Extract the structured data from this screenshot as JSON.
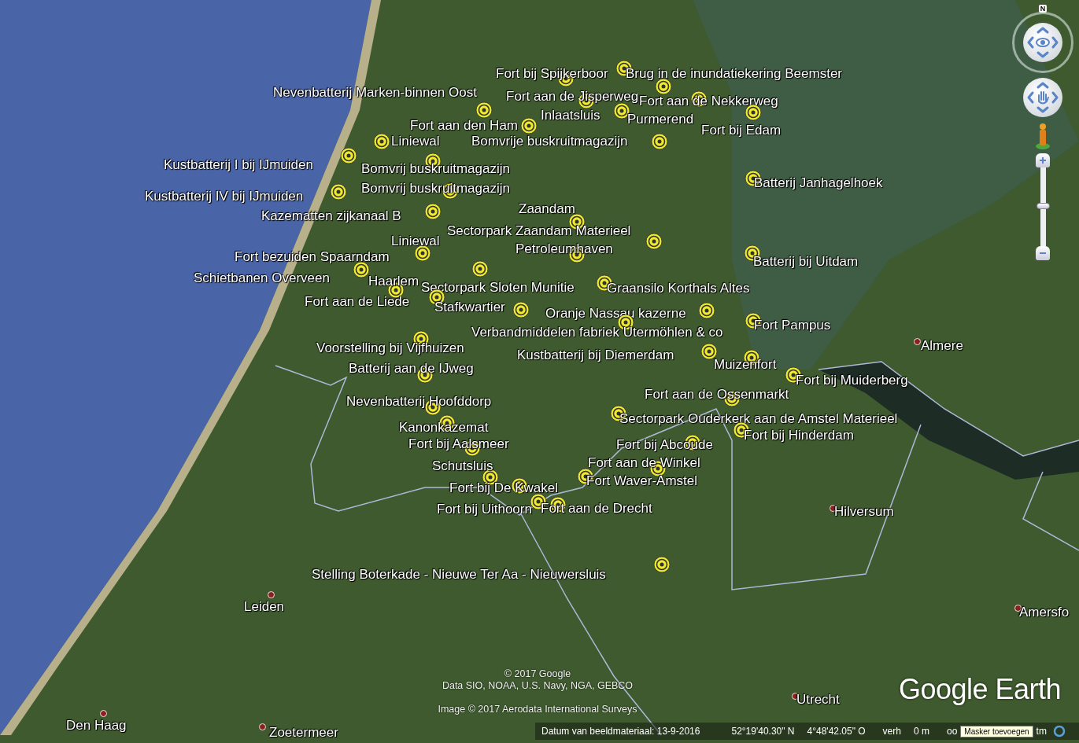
{
  "map": {
    "placemarks": [
      {
        "kind": "placemark",
        "label": "Fort bij Spijkerboor"
      },
      {
        "kind": "placemark",
        "label": "Brug in de inundatiekering Beemster"
      },
      {
        "kind": "placemark",
        "label": "Nevenbatterij Marken-binnen Oost"
      },
      {
        "kind": "placemark",
        "label": "Fort aan de Jisperweg"
      },
      {
        "kind": "placemark",
        "label": "Fort aan de Nekkerweg"
      },
      {
        "kind": "placemark",
        "label": "Inlaatsluis"
      },
      {
        "kind": "placemark",
        "label": "Purmerend"
      },
      {
        "kind": "placemark",
        "label": "Fort bij Edam"
      },
      {
        "kind": "placemark",
        "label": "Fort aan den Ham"
      },
      {
        "kind": "placemark",
        "label": "Liniewal"
      },
      {
        "kind": "placemark",
        "label": "Bomvrije buskruitmagazijn"
      },
      {
        "kind": "placemark",
        "label": "Kustbatterij I bij IJmuiden"
      },
      {
        "kind": "placemark",
        "label": "Bomvrij buskruitmagazijn"
      },
      {
        "kind": "placemark",
        "label": "Bomvrij buskruitmagazijn"
      },
      {
        "kind": "placemark",
        "label": "Kustbatterij IV bij IJmuiden"
      },
      {
        "kind": "placemark",
        "label": "Kazematten zijkanaal B"
      },
      {
        "kind": "placemark",
        "label": "Zaandam"
      },
      {
        "kind": "placemark",
        "label": "Batterij Janhagelhoek"
      },
      {
        "kind": "placemark",
        "label": "Liniewal"
      },
      {
        "kind": "placemark",
        "label": "Sectorpark Zaandam Materieel"
      },
      {
        "kind": "placemark",
        "label": "Petroleumhaven"
      },
      {
        "kind": "placemark",
        "label": "Batterij bij Uitdam"
      },
      {
        "kind": "placemark",
        "label": "Fort bezuiden Spaarndam"
      },
      {
        "kind": "placemark",
        "label": "Schietbanen Overveen"
      },
      {
        "kind": "placemark",
        "label": "Haarlem"
      },
      {
        "kind": "placemark",
        "label": "Sectorpark Sloten Munitie"
      },
      {
        "kind": "placemark",
        "label": "Graansilo Korthals Altes"
      },
      {
        "kind": "placemark",
        "label": "Fort aan de Liede"
      },
      {
        "kind": "placemark",
        "label": "Stafkwartier"
      },
      {
        "kind": "placemark",
        "label": "Oranje Nassau kazerne"
      },
      {
        "kind": "placemark",
        "label": "Fort Pampus"
      },
      {
        "kind": "placemark",
        "label": "Verbandmiddelen fabriek Utermöhlen & co"
      },
      {
        "kind": "placemark",
        "label": "Voorstelling bij Vijfhuizen"
      },
      {
        "kind": "placemark",
        "label": "Kustbatterij bij Diemerdam"
      },
      {
        "kind": "placemark",
        "label": "Muizenfort"
      },
      {
        "kind": "placemark",
        "label": "Batterij aan de IJweg"
      },
      {
        "kind": "city",
        "label": "Almere"
      },
      {
        "kind": "placemark",
        "label": "Fort bij Muiderberg"
      },
      {
        "kind": "placemark",
        "label": "Fort aan de Ossenmarkt"
      },
      {
        "kind": "placemark",
        "label": "Nevenbatterij Hoofddorp"
      },
      {
        "kind": "placemark",
        "label": "Sectorpark Ouderkerk aan de Amstel Materieel"
      },
      {
        "kind": "placemark",
        "label": "Kanonkazemat"
      },
      {
        "kind": "placemark",
        "label": "Fort bij Hinderdam"
      },
      {
        "kind": "placemark",
        "label": "Fort bij Aalsmeer"
      },
      {
        "kind": "placemark",
        "label": "Fort bij Abcoude"
      },
      {
        "kind": "placemark",
        "label": "Fort aan de Winkel"
      },
      {
        "kind": "placemark",
        "label": "Schutsluis"
      },
      {
        "kind": "placemark",
        "label": "Fort Waver-Amstel"
      },
      {
        "kind": "placemark",
        "label": "Fort bij De Kwakel"
      },
      {
        "kind": "placemark",
        "label": "Fort bij Uithoorn"
      },
      {
        "kind": "placemark",
        "label": "Fort aan de Drecht"
      },
      {
        "kind": "city",
        "label": "Hilversum"
      },
      {
        "kind": "placemark",
        "label": "Stelling Boterkade - Nieuwe Ter Aa - Nieuwersluis"
      },
      {
        "kind": "city",
        "label": "Leiden"
      },
      {
        "kind": "city",
        "label": "Amersfo"
      },
      {
        "kind": "city",
        "label": "Utrecht"
      },
      {
        "kind": "city",
        "label": "Den Haag"
      },
      {
        "kind": "city",
        "label": "Zoetermeer"
      }
    ]
  },
  "attribution": [
    "© 2017 Google",
    "Data SIO, NOAA, U.S. Navy, NGA, GEBCO",
    "Image © 2017 Aerodata International Surveys"
  ],
  "logo": {
    "text": "Google Earth"
  },
  "navigation": {
    "compass_label": "N",
    "zoom": {
      "level": 0.51
    }
  },
  "status_bar": {
    "items": [
      "Datum van beeldmateriaal: 13-9-2016",
      "52°19'40.30\" N",
      "4°48'42.05\" O",
      "verh",
      "0 m",
      "oo",
      "tm"
    ],
    "tooltip": "Masker toevoegen"
  }
}
